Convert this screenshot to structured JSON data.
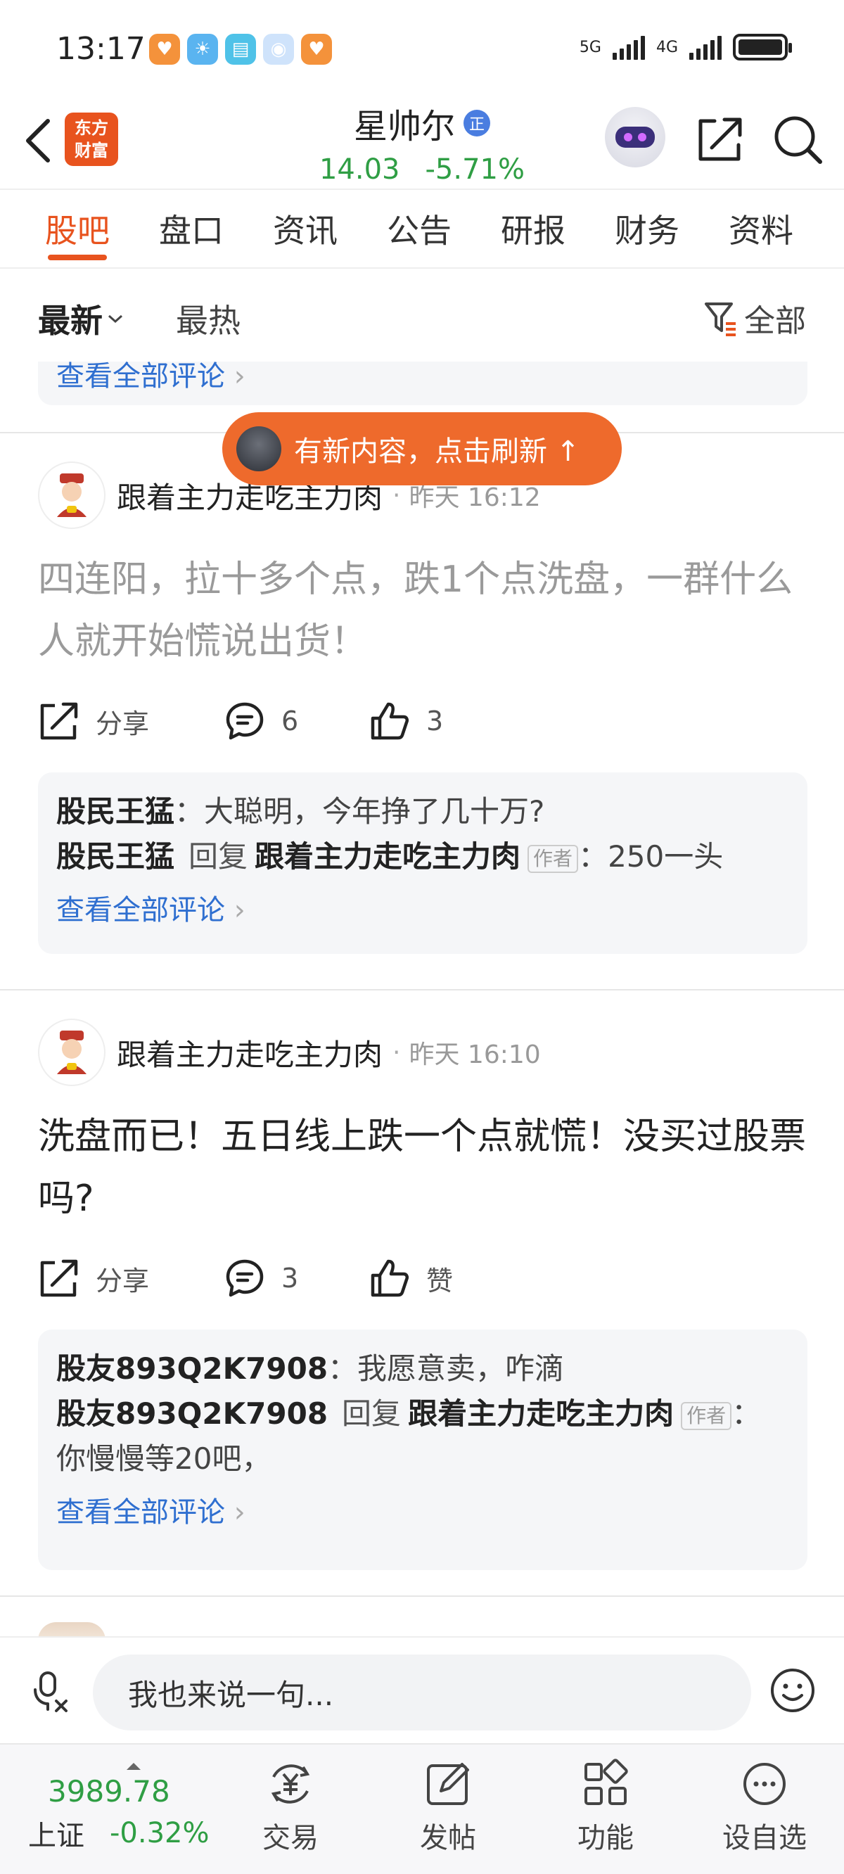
{
  "status_bar": {
    "time": "13:17",
    "net1": "5G",
    "net2": "4G"
  },
  "header": {
    "logo_line1": "东方",
    "logo_line2": "财富",
    "stock_name": "星帅尔",
    "stock_badge": "正",
    "price": "14.03",
    "change": "-5.71%"
  },
  "tabs": [
    "股吧",
    "盘口",
    "资讯",
    "公告",
    "研报",
    "财务",
    "资料"
  ],
  "filter": {
    "latest": "最新",
    "hot": "最热",
    "all": "全部"
  },
  "prev_card": {
    "view_all": "查看全部评论"
  },
  "toast": {
    "text": "有新内容，点击刷新 ↑"
  },
  "posts": [
    {
      "author": "跟着主力走吃主力肉",
      "time": "昨天 16:12",
      "content": "四连阳，拉十多个点，跌1个点洗盘，一群什么人就开始慌说出货！",
      "share_label": "分享",
      "comment_count": "6",
      "like_label": "3",
      "comments": [
        {
          "user": "股民王猛",
          "text": "：大聪明，今年挣了几十万?"
        },
        {
          "user": "股民王猛",
          "reply_word": "回复",
          "reply_to": "跟着主力走吃主力肉",
          "tag": "作者",
          "text": "：250一头"
        }
      ],
      "view_all": "查看全部评论"
    },
    {
      "author": "跟着主力走吃主力肉",
      "time": "昨天 16:10",
      "content": "洗盘而已！五日线上跌一个点就慌！没买过股票吗?",
      "share_label": "分享",
      "comment_count": "3",
      "like_label": "赞",
      "comments": [
        {
          "user": "股友893Q2K7908",
          "text": "：我愿意卖，咋滴"
        },
        {
          "user": "股友893Q2K7908",
          "reply_word": "回复",
          "reply_to": "跟着主力走吃主力肉",
          "tag": "作者",
          "text": "：你慢慢等20吧，"
        }
      ],
      "view_all": "查看全部评论"
    }
  ],
  "input": {
    "placeholder": "我也来说一句..."
  },
  "bottom": {
    "index_value": "3989.78",
    "index_name": "上证",
    "index_change": "-0.32%",
    "trade": "交易",
    "post": "发帖",
    "features": "功能",
    "watchlist": "设自选"
  },
  "colors": {
    "accent": "#e8531e",
    "down": "#2f9e44",
    "link": "#2f6fd0"
  }
}
